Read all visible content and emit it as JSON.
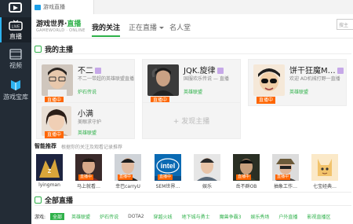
{
  "tab": {
    "title": "游戏直播"
  },
  "rail": {
    "items": [
      {
        "label": "直播",
        "icon": "live-tv-icon",
        "active": true
      },
      {
        "label": "视频",
        "icon": "video-icon",
        "active": false
      },
      {
        "label": "游戏宝库",
        "icon": "game-library-icon",
        "active": false
      }
    ]
  },
  "header": {
    "brand_main": "游戏世界·",
    "brand_accent": "直播",
    "brand_sub": "GAMEWORLD · ONLINE",
    "nav_follow": "我的关注",
    "nav_live": "正在直播",
    "nav_fame": "名人堂",
    "search_placeholder": "搜主"
  },
  "my_anchors": {
    "title": "我的主播",
    "live_badge": "直播中",
    "cards": [
      {
        "name": "不二",
        "room": "不二一带超的英雄联盟直播",
        "game": "炉石传说"
      },
      {
        "name": "JQK.旋律",
        "room": "国服欢乐传说 — 直播",
        "game": "英雄联盟"
      },
      {
        "name": "饼干狂魔M…",
        "room": "欢迎 AD机械打野一直播",
        "game": "英雄联盟"
      },
      {
        "name": "小满",
        "room": "美眼求守护",
        "game": "英雄联盟"
      }
    ],
    "discover_label": "+ 发现主播"
  },
  "recommend": {
    "title": "智能推荐",
    "desc": "根据你的关注及观看记录推荐",
    "live_badge": "直播中",
    "items": [
      {
        "name": "lyingman"
      },
      {
        "name": "马上就看…"
      },
      {
        "name": "幸巴carryU"
      },
      {
        "name": "SEM世界…"
      },
      {
        "name": "娱乐"
      },
      {
        "name": "岳不群OB"
      },
      {
        "name": "抽象工作…"
      },
      {
        "name": "七宝经典…"
      }
    ]
  },
  "all_live": {
    "title": "全部直播",
    "filter_label": "游戏:",
    "filters": [
      "全部",
      "英雄联盟",
      "炉石传说",
      "DOTA2",
      "穿越火线",
      "地下城与勇士",
      "魔兽争霸3",
      "娱乐秀场",
      "户外直播",
      "影视直播区"
    ]
  },
  "colors": {
    "accent": "#2fb14a",
    "live_badge": "#ff6600",
    "rail": "#232c36"
  }
}
